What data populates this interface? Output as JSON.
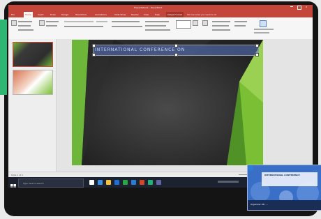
{
  "app": {
    "window_title": "Presentation1 - PowerPoint",
    "tabs": [
      "File",
      "Home",
      "Insert",
      "Draw",
      "Design",
      "Transitions",
      "Animations",
      "Slide Show",
      "Review",
      "View",
      "Help",
      "Shape Format"
    ],
    "search_placeholder": "Tell me what you want to do"
  },
  "slide": {
    "title": "INTERNATIONAL CONFERENCE ON"
  },
  "statusbar": {
    "slide_count": "Slide 1 of 2"
  },
  "taskbar": {
    "search_placeholder": "Type here to search"
  },
  "popup": {
    "heading": "INTERNATIONAL CONFERENCE",
    "footer_text": "Organizer: Mr. ..."
  },
  "colors": {
    "ribbon_red": "#c4463a",
    "slide_bg": "#3a3a3a",
    "slide_green": "#7bbf34",
    "taskbar": "#1d2230"
  }
}
